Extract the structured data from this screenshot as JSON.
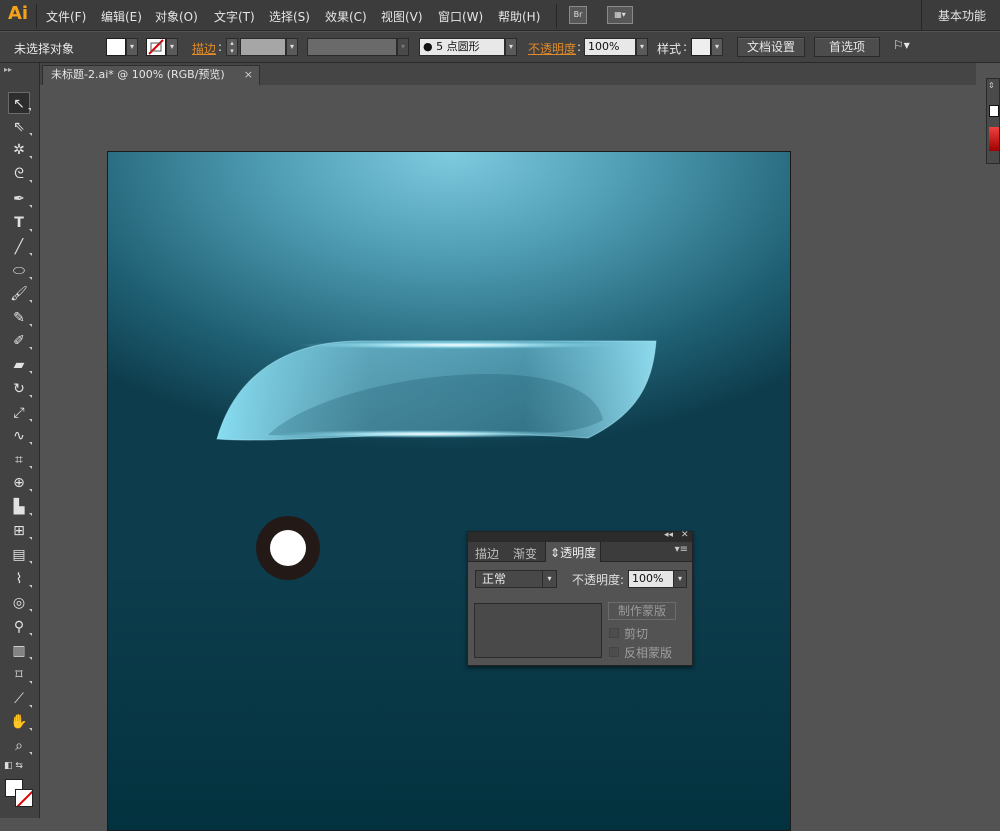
{
  "app": {
    "logo": "Ai",
    "workspace": "基本功能"
  },
  "menu": [
    "文件(F)",
    "编辑(E)",
    "对象(O)",
    "文字(T)",
    "选择(S)",
    "效果(C)",
    "视图(V)",
    "窗口(W)",
    "帮助(H)"
  ],
  "menu_icons": [
    "Br",
    "arrange-icon"
  ],
  "control": {
    "selection": "未选择对象",
    "stroke_label": "描边",
    "brush_label": "5 点圆形",
    "opacity_label": "不透明度",
    "opacity_value": "100%",
    "style_label": "样式",
    "doc_setup": "文档设置",
    "preferences": "首选项"
  },
  "document": {
    "tab_title": "未标题-2.ai* @ 100% (RGB/预览)",
    "close": "×"
  },
  "panel": {
    "collapse": "◂◂",
    "close": "✕",
    "tabs": [
      "描边",
      "渐变",
      "透明度"
    ],
    "blend_mode": "正常",
    "opacity_label": "不透明度",
    "opacity_value": "100%",
    "make_mask": "制作蒙版",
    "clip": "剪切",
    "invert_mask": "反相蒙版"
  },
  "colors": {
    "accent": "#f4a21c",
    "canvas_top": "#7ecbe0",
    "canvas_bottom": "#03323f"
  }
}
